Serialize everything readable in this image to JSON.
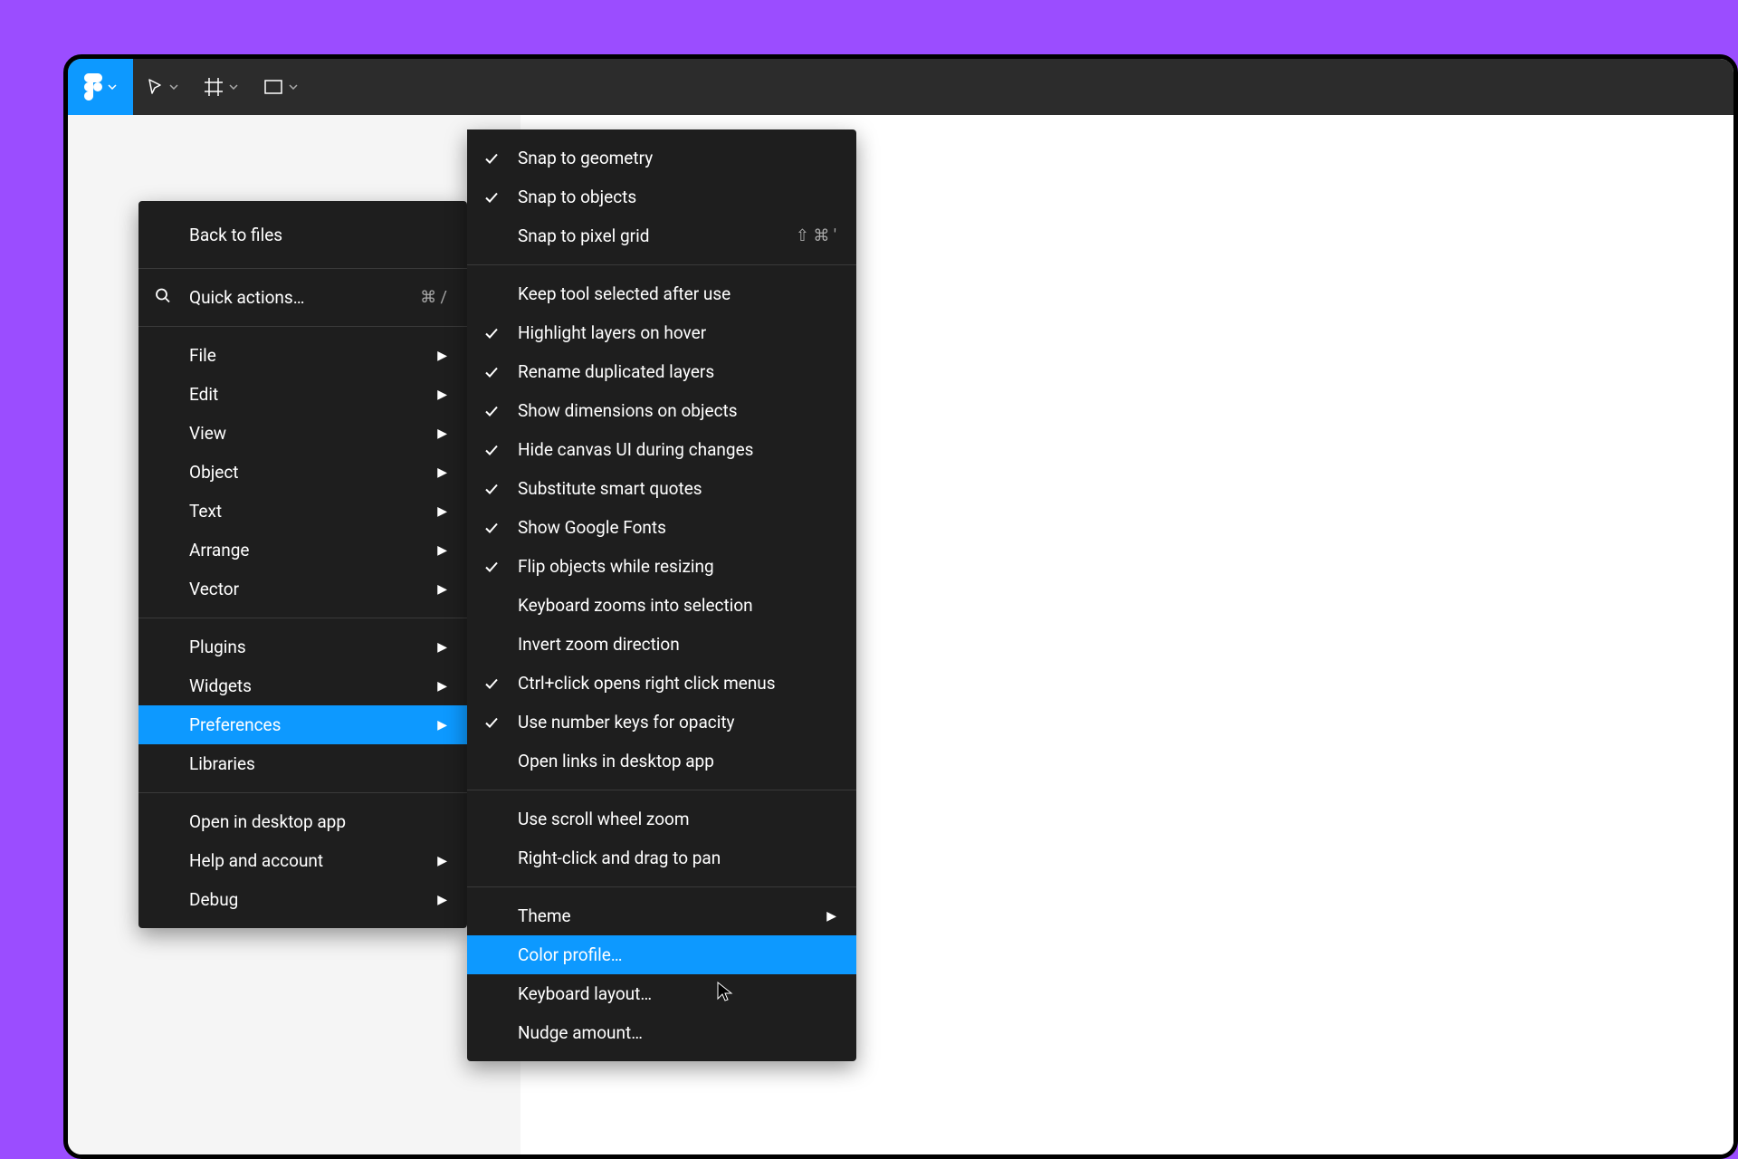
{
  "toolbar": {
    "tools": [
      "figma-menu",
      "move-tool",
      "frame-tool",
      "rectangle-tool"
    ]
  },
  "mainMenu": {
    "back": "Back to files",
    "quickActions": {
      "label": "Quick actions…",
      "shortcut": "⌘ /"
    },
    "group1": [
      {
        "label": "File",
        "hasSubmenu": true
      },
      {
        "label": "Edit",
        "hasSubmenu": true
      },
      {
        "label": "View",
        "hasSubmenu": true
      },
      {
        "label": "Object",
        "hasSubmenu": true
      },
      {
        "label": "Text",
        "hasSubmenu": true
      },
      {
        "label": "Arrange",
        "hasSubmenu": true
      },
      {
        "label": "Vector",
        "hasSubmenu": true
      }
    ],
    "group2": [
      {
        "label": "Plugins",
        "hasSubmenu": true
      },
      {
        "label": "Widgets",
        "hasSubmenu": true
      },
      {
        "label": "Preferences",
        "hasSubmenu": true,
        "highlighted": true
      },
      {
        "label": "Libraries",
        "hasSubmenu": false
      }
    ],
    "group3": [
      {
        "label": "Open in desktop app",
        "hasSubmenu": false
      },
      {
        "label": "Help and account",
        "hasSubmenu": true
      },
      {
        "label": "Debug",
        "hasSubmenu": true
      }
    ]
  },
  "preferencesMenu": {
    "group1": [
      {
        "label": "Snap to geometry",
        "checked": true
      },
      {
        "label": "Snap to objects",
        "checked": true
      },
      {
        "label": "Snap to pixel grid",
        "checked": false,
        "shortcut": "⇧ ⌘ '"
      }
    ],
    "group2": [
      {
        "label": "Keep tool selected after use",
        "checked": false
      },
      {
        "label": "Highlight layers on hover",
        "checked": true
      },
      {
        "label": "Rename duplicated layers",
        "checked": true
      },
      {
        "label": "Show dimensions on objects",
        "checked": true
      },
      {
        "label": "Hide canvas UI during changes",
        "checked": true
      },
      {
        "label": "Substitute smart quotes",
        "checked": true
      },
      {
        "label": "Show Google Fonts",
        "checked": true
      },
      {
        "label": "Flip objects while resizing",
        "checked": true
      },
      {
        "label": "Keyboard zooms into selection",
        "checked": false
      },
      {
        "label": "Invert zoom direction",
        "checked": false
      },
      {
        "label": "Ctrl+click opens right click menus",
        "checked": true
      },
      {
        "label": "Use number keys for opacity",
        "checked": true
      },
      {
        "label": "Open links in desktop app",
        "checked": false
      }
    ],
    "group3": [
      {
        "label": "Use scroll wheel zoom",
        "checked": false
      },
      {
        "label": "Right-click and drag to pan",
        "checked": false
      }
    ],
    "group4": [
      {
        "label": "Theme",
        "hasSubmenu": true
      },
      {
        "label": "Color profile…",
        "highlighted": true
      },
      {
        "label": "Keyboard layout…"
      },
      {
        "label": "Nudge amount…"
      }
    ]
  }
}
